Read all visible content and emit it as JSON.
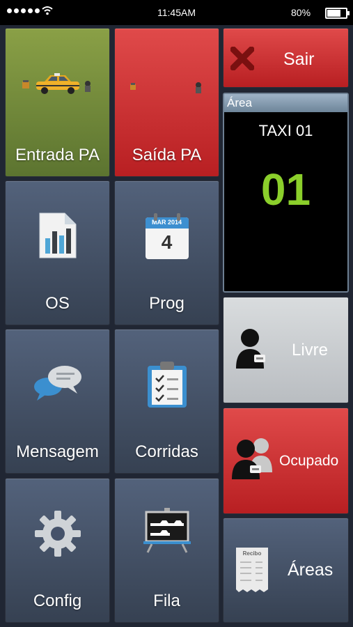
{
  "status_bar": {
    "time": "11:45AM",
    "battery_percent": "80%",
    "battery_level": 0.8
  },
  "tiles": {
    "entrada": "Entrada PA",
    "saida": "Saída PA",
    "os": "OS",
    "prog": "Prog",
    "mensagem": "Mensagem",
    "corridas": "Corridas",
    "config": "Config",
    "fila": "Fila"
  },
  "sair": {
    "label": "Sair"
  },
  "area": {
    "header": "Área",
    "name": "TAXI 01",
    "number": "01"
  },
  "livre": {
    "label": "Livre"
  },
  "ocupado": {
    "label": "Ocupado"
  },
  "areas": {
    "label": "Áreas"
  },
  "calendar_icon": {
    "month": "MAR 2014",
    "day": "4"
  },
  "receipt_icon": {
    "title": "Recibo"
  },
  "colors": {
    "green_tile": "#7b9440",
    "red_tile": "#cf2f31",
    "gray_tile": "#c9cccf",
    "area_number": "#8bcf2b",
    "dark_tile": "#47546a"
  },
  "icons": {
    "entrada": "taxi-entry-icon",
    "saida": "taxi-exit-icon",
    "os": "report-chart-icon",
    "prog": "calendar-icon",
    "mensagem": "chat-bubbles-icon",
    "corridas": "checklist-clipboard-icon",
    "config": "gear-icon",
    "fila": "queue-board-icon",
    "sair": "close-x-icon",
    "livre": "driver-person-icon",
    "ocupado": "driver-passenger-icon",
    "areas": "receipt-icon"
  }
}
